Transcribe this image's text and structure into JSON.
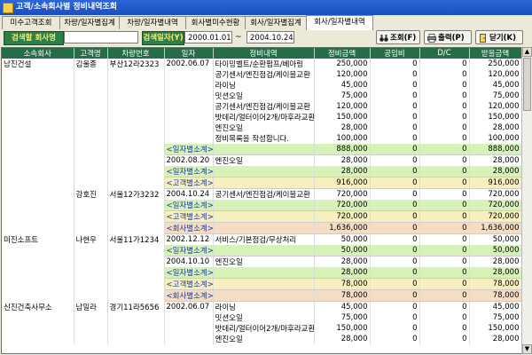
{
  "window": {
    "title": "고객/소속회사별 정비내역조회"
  },
  "tabs": [
    "미수고객조회",
    "차량/일자별집계",
    "차량/일자별내역",
    "회사별미수현황",
    "회사/일자별집계",
    "회사/일자별내역"
  ],
  "filters": {
    "company_label": "검색할 회사명",
    "company_value": "",
    "date_label": "검색일자(Y)",
    "date_from": "2000.01.01",
    "date_sep": "~",
    "date_to": "2004.10.24"
  },
  "buttons": {
    "search": "조회(F)",
    "print": "출력(P)",
    "close": "닫기(K)"
  },
  "columns": [
    "소속회사",
    "고객명",
    "차량번호",
    "일자",
    "정비내역",
    "정비금액",
    "공임비",
    "D/C",
    "받을금액"
  ],
  "rows": [
    {
      "company": "남진건설",
      "customer": "김울종",
      "car": "부산12라2323",
      "date": "2002.06.07",
      "desc": "타이밍벨트/순환펌프/베아링",
      "amount": "250,000",
      "labor": "0",
      "dc": "0",
      "receivable": "250,000",
      "type": ""
    },
    {
      "company": "",
      "customer": "",
      "car": "",
      "date": "",
      "desc": "공기센서/엔진점검/케이블교환",
      "amount": "120,000",
      "labor": "0",
      "dc": "0",
      "receivable": "120,000",
      "type": ""
    },
    {
      "company": "",
      "customer": "",
      "car": "",
      "date": "",
      "desc": "라이닝",
      "amount": "45,000",
      "labor": "0",
      "dc": "0",
      "receivable": "45,000",
      "type": ""
    },
    {
      "company": "",
      "customer": "",
      "car": "",
      "date": "",
      "desc": "밋션오일",
      "amount": "75,000",
      "labor": "0",
      "dc": "0",
      "receivable": "75,000",
      "type": ""
    },
    {
      "company": "",
      "customer": "",
      "car": "",
      "date": "",
      "desc": "공기센서/엔진점검/케이블교환",
      "amount": "120,000",
      "labor": "0",
      "dc": "0",
      "receivable": "120,000",
      "type": ""
    },
    {
      "company": "",
      "customer": "",
      "car": "",
      "date": "",
      "desc": "밧데리/얼터이어2개/마후라교환",
      "amount": "150,000",
      "labor": "0",
      "dc": "0",
      "receivable": "150,000",
      "type": ""
    },
    {
      "company": "",
      "customer": "",
      "car": "",
      "date": "",
      "desc": "엔진오일",
      "amount": "28,000",
      "labor": "0",
      "dc": "0",
      "receivable": "28,000",
      "type": ""
    },
    {
      "company": "",
      "customer": "",
      "car": "",
      "date": "",
      "desc": "정비목록을 작성합니다.",
      "amount": "100,000",
      "labor": "0",
      "dc": "0",
      "receivable": "100,000",
      "type": ""
    },
    {
      "company": "",
      "customer": "",
      "car": "",
      "date": "<일자별소계>",
      "desc": "",
      "amount": "888,000",
      "labor": "0",
      "dc": "0",
      "receivable": "888,000",
      "type": "date"
    },
    {
      "company": "",
      "customer": "",
      "car": "",
      "date": "2002.08.20",
      "desc": "엔진오일",
      "amount": "28,000",
      "labor": "0",
      "dc": "0",
      "receivable": "28,000",
      "type": ""
    },
    {
      "company": "",
      "customer": "",
      "car": "",
      "date": "<일자별소계>",
      "desc": "",
      "amount": "28,000",
      "labor": "0",
      "dc": "0",
      "receivable": "28,000",
      "type": "date"
    },
    {
      "company": "",
      "customer": "",
      "car": "",
      "date": "<고객별소계>",
      "desc": "",
      "amount": "916,000",
      "labor": "0",
      "dc": "0",
      "receivable": "916,000",
      "type": "cust"
    },
    {
      "company": "",
      "customer": "강호진",
      "car": "서울12가3232",
      "date": "2004.10.24",
      "desc": "공기센서/엔진점검/케이블교환",
      "amount": "720,000",
      "labor": "0",
      "dc": "0",
      "receivable": "720,000",
      "type": ""
    },
    {
      "company": "",
      "customer": "",
      "car": "",
      "date": "<일자별소계>",
      "desc": "",
      "amount": "720,000",
      "labor": "0",
      "dc": "0",
      "receivable": "720,000",
      "type": "date"
    },
    {
      "company": "",
      "customer": "",
      "car": "",
      "date": "<고객별소계>",
      "desc": "",
      "amount": "720,000",
      "labor": "0",
      "dc": "0",
      "receivable": "720,000",
      "type": "cust"
    },
    {
      "company": "",
      "customer": "",
      "car": "",
      "date": "<회사별소계>",
      "desc": "",
      "amount": "1,636,000",
      "labor": "0",
      "dc": "0",
      "receivable": "1,636,000",
      "type": "comp"
    },
    {
      "company": "미진소프트",
      "customer": "나현우",
      "car": "서울11가1234",
      "date": "2002.12.12",
      "desc": "서비스/기본점검/무상처리",
      "amount": "50,000",
      "labor": "0",
      "dc": "0",
      "receivable": "50,000",
      "type": ""
    },
    {
      "company": "",
      "customer": "",
      "car": "",
      "date": "<일자별소계>",
      "desc": "",
      "amount": "50,000",
      "labor": "0",
      "dc": "0",
      "receivable": "50,000",
      "type": "date"
    },
    {
      "company": "",
      "customer": "",
      "car": "",
      "date": "2004.10.10",
      "desc": "엔진오일",
      "amount": "28,000",
      "labor": "0",
      "dc": "0",
      "receivable": "28,000",
      "type": ""
    },
    {
      "company": "",
      "customer": "",
      "car": "",
      "date": "<일자별소계>",
      "desc": "",
      "amount": "28,000",
      "labor": "0",
      "dc": "0",
      "receivable": "28,000",
      "type": "date"
    },
    {
      "company": "",
      "customer": "",
      "car": "",
      "date": "<고객별소계>",
      "desc": "",
      "amount": "78,000",
      "labor": "0",
      "dc": "0",
      "receivable": "78,000",
      "type": "cust"
    },
    {
      "company": "",
      "customer": "",
      "car": "",
      "date": "<회사별소계>",
      "desc": "",
      "amount": "78,000",
      "labor": "0",
      "dc": "0",
      "receivable": "78,000",
      "type": "comp"
    },
    {
      "company": "신진건축사무소",
      "customer": "남일라",
      "car": "경기11라5656",
      "date": "2002.06.07",
      "desc": "라이닝",
      "amount": "45,000",
      "labor": "0",
      "dc": "0",
      "receivable": "45,000",
      "type": ""
    },
    {
      "company": "",
      "customer": "",
      "car": "",
      "date": "",
      "desc": "밋션오일",
      "amount": "75,000",
      "labor": "0",
      "dc": "0",
      "receivable": "75,000",
      "type": ""
    },
    {
      "company": "",
      "customer": "",
      "car": "",
      "date": "",
      "desc": "밧데리/얼터이어2개/마후라교환",
      "amount": "150,000",
      "labor": "0",
      "dc": "0",
      "receivable": "150,000",
      "type": ""
    },
    {
      "company": "",
      "customer": "",
      "car": "",
      "date": "",
      "desc": "엔진오일",
      "amount": "28,000",
      "labor": "0",
      "dc": "0",
      "receivable": "28,000",
      "type": ""
    }
  ]
}
